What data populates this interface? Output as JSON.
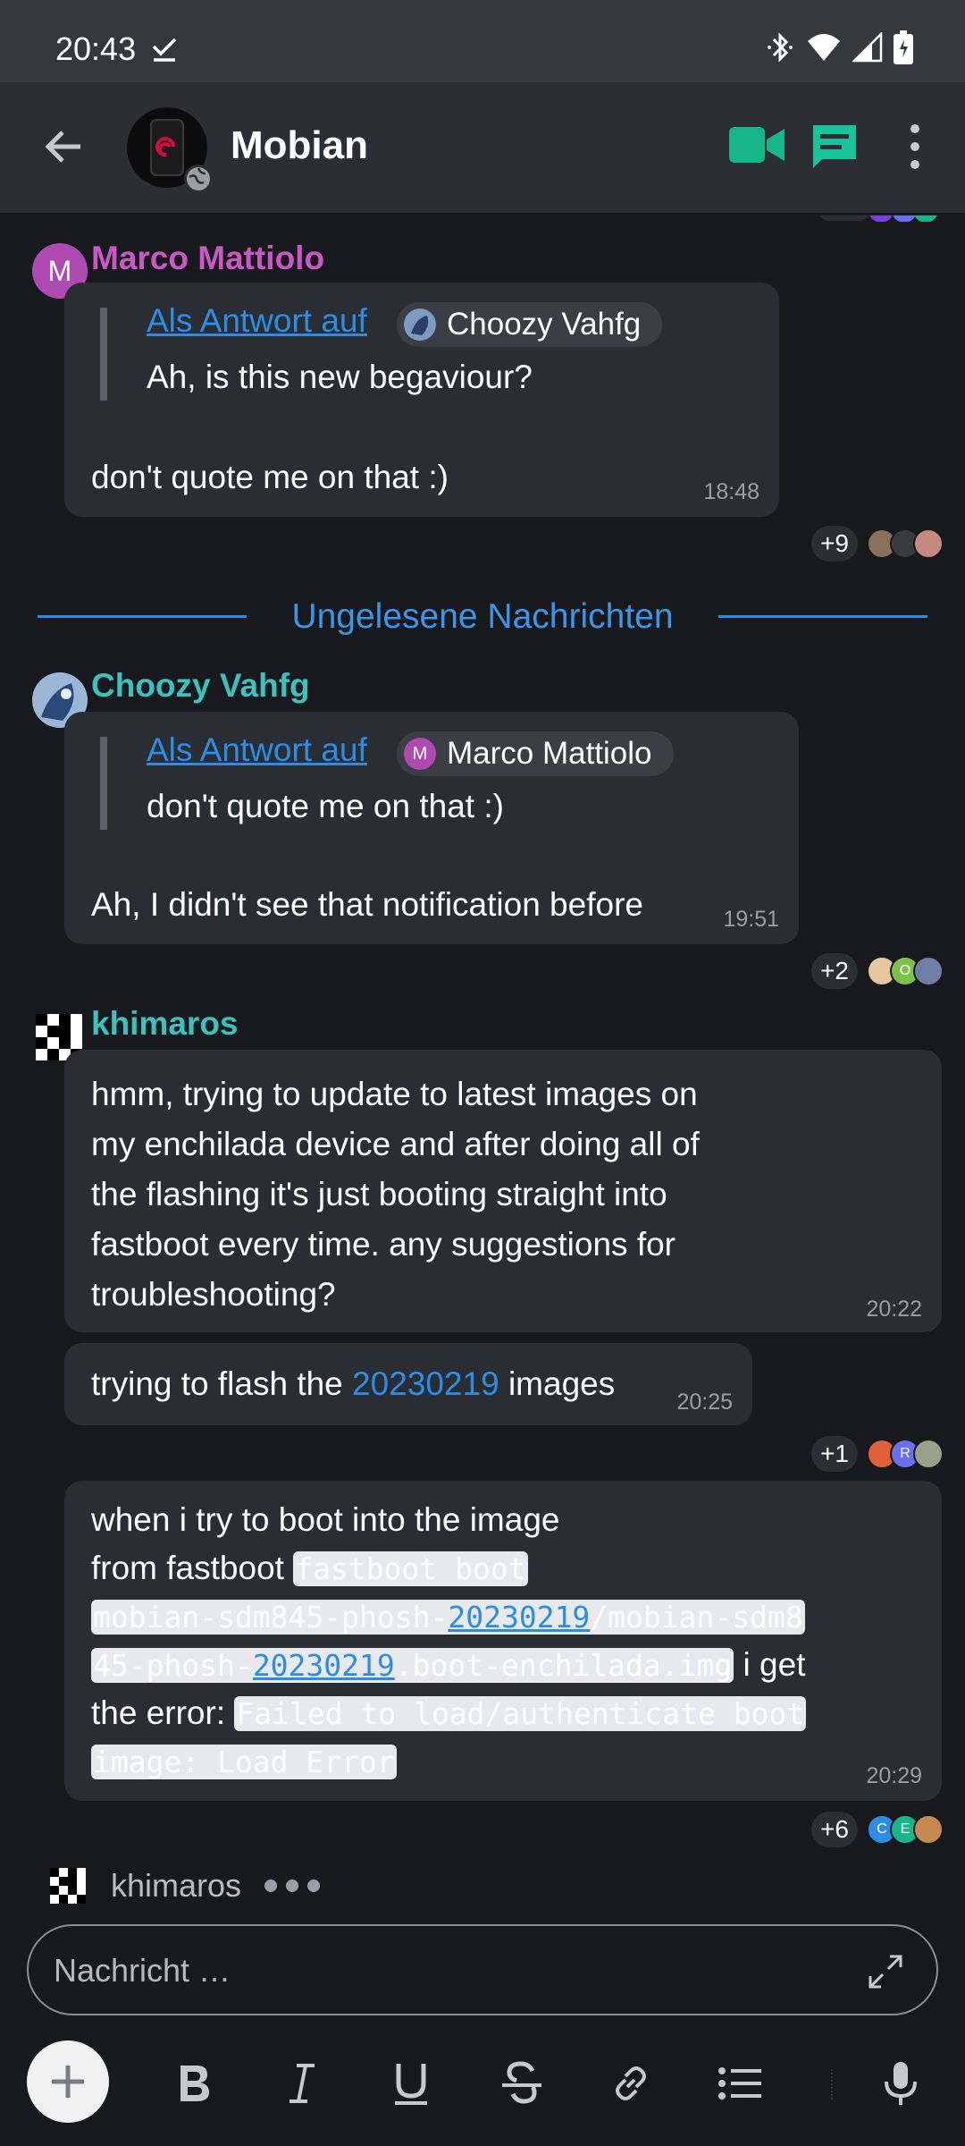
{
  "status_bar": {
    "time": "20:43",
    "icons": [
      "download-done-icon",
      "bluetooth-icon",
      "wifi-icon",
      "signal-icon",
      "battery-icon"
    ]
  },
  "app_bar": {
    "title": "Mobian",
    "icons": [
      "back-arrow-icon",
      "video-call-icon",
      "threads-icon",
      "more-vert-icon"
    ]
  },
  "colors": {
    "background": "#17191c",
    "bubble": "#2a2d32",
    "accent_blue": "#2b8de6",
    "video_green": "#16b58a",
    "thread_green": "#18c49a",
    "marco": "#c957c4",
    "teal": "#3cc2be"
  },
  "messages": [
    {
      "sender": "Marco Mattiolo",
      "avatar_letter": "M",
      "reply_prefix": "Als Antwort auf",
      "reply_to": "Choozy Vahfg",
      "quoted": "Ah, is this new begaviour?",
      "text": "don't quote me on that :)",
      "time": "18:48",
      "receipt_count": "+9"
    },
    {
      "sender": "Choozy Vahfg",
      "reply_prefix": "Als Antwort auf",
      "reply_to": "Marco Mattiolo",
      "reply_to_letter": "M",
      "quoted": "don't quote me on that :)",
      "text": "Ah, I didn't see that notification before",
      "time": "19:51",
      "receipt_count": "+2",
      "receipt_letters": [
        "O"
      ]
    },
    {
      "sender": "khimaros",
      "lines": [
        "hmm, trying to update to latest images on",
        "my enchilada device and after doing all of",
        "the flashing it's just booting straight into",
        "fastboot every time. any suggestions for",
        "troubleshooting?"
      ],
      "time": "20:22"
    },
    {
      "sender": "khimaros",
      "text_before": "trying to flash the",
      "ref": "20230219",
      "text_after": "images",
      "time": "20:25",
      "receipt_count": "+1",
      "receipt_letters": [
        "R"
      ]
    },
    {
      "sender": "khimaros",
      "line1": "when i try to boot into the image",
      "line2_text": "from fastboot",
      "code1_a": "fastboot boot",
      "code1_b_pre": "mobian-sdm845-phosh-",
      "code1_b_ref": "20230219",
      "code1_b_post": "/mobian-sdm8",
      "code1_c_pre": "45-phosh-",
      "code1_c_ref": "20230219",
      "code1_c_post": ".boot-enchilada.img",
      "text_mid": "i get",
      "text_err": "the error:",
      "code2_a": "Failed to load/authenticate boot",
      "code2_b": "image: Load Error",
      "time": "20:29",
      "receipt_count": "+6",
      "receipt_letters": [
        "C",
        "E"
      ]
    }
  ],
  "unread_divider": "Ungelesene Nachrichten",
  "typing": {
    "name": "khimaros"
  },
  "composer": {
    "placeholder": "Nachricht …"
  },
  "toolbar": [
    "add-icon",
    "bold-icon",
    "italic-icon",
    "underline-icon",
    "strikethrough-icon",
    "link-icon",
    "list-icon",
    "mic-icon"
  ]
}
